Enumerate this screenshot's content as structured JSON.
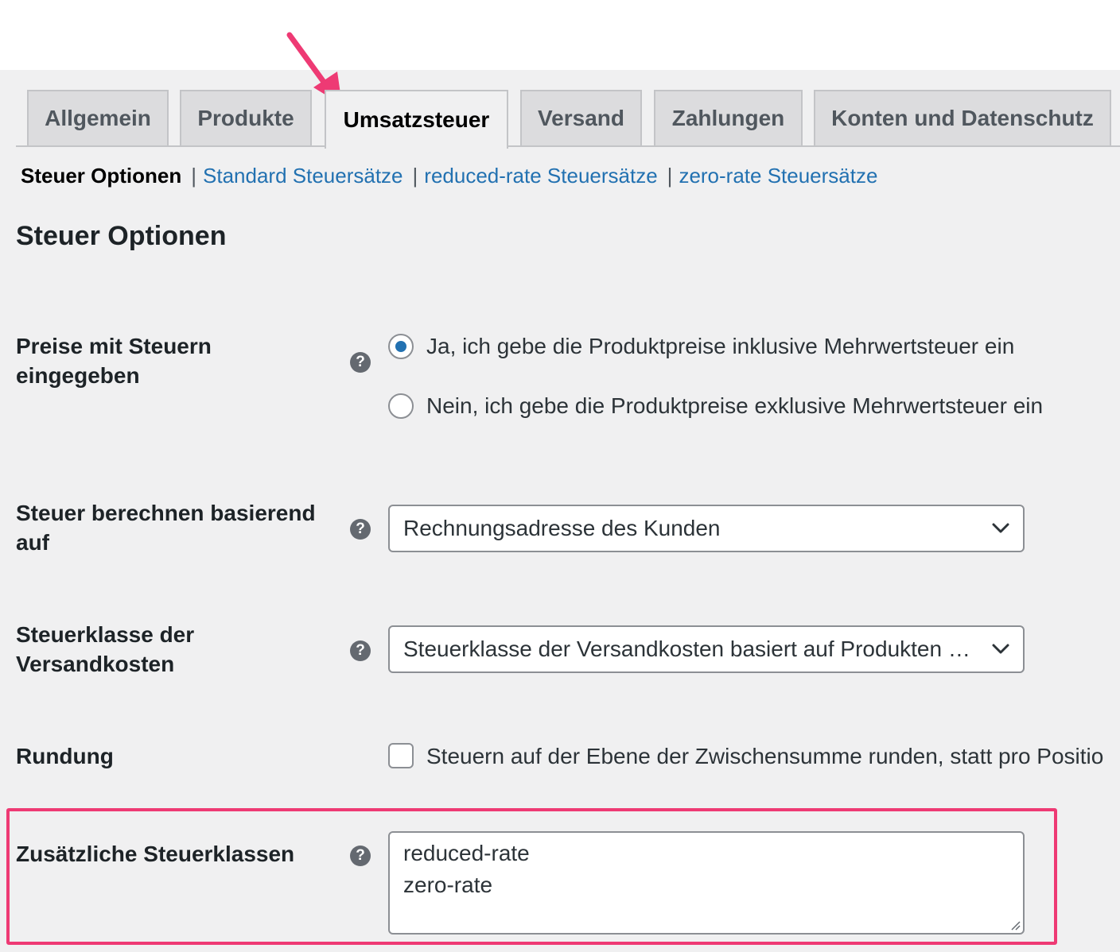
{
  "tabs": [
    {
      "label": "Allgemein"
    },
    {
      "label": "Produkte"
    },
    {
      "label": "Umsatzsteuer",
      "active": true
    },
    {
      "label": "Versand"
    },
    {
      "label": "Zahlungen"
    },
    {
      "label": "Konten und Datenschutz"
    }
  ],
  "subnav": {
    "current": "Steuer Optionen",
    "separator": "|",
    "links": [
      "Standard Steuersätze",
      "reduced-rate Steuersätze",
      "zero-rate Steuersätze"
    ]
  },
  "section_title": "Steuer Optionen",
  "fields": {
    "prices_incl_tax": {
      "label": "Preise mit Steuern eingegeben",
      "options": [
        {
          "label": "Ja, ich gebe die Produktpreise inklusive Mehrwertsteuer ein",
          "checked": true
        },
        {
          "label": "Nein, ich gebe die Produktpreise exklusive Mehrwertsteuer ein",
          "checked": false
        }
      ]
    },
    "tax_based_on": {
      "label": "Steuer berechnen basierend auf",
      "value": "Rechnungsadresse des Kunden"
    },
    "shipping_tax_class": {
      "label": "Steuerklasse der Versandkosten",
      "value": "Steuerklasse der Versandkosten basiert auf Produkten …"
    },
    "rounding": {
      "label": "Rundung",
      "checkbox_label": "Steuern auf der Ebene der Zwischensumme runden, statt pro Positio",
      "checked": false
    },
    "additional_tax_classes": {
      "label": "Zusätzliche Steuerklassen",
      "lines": [
        "reduced-rate",
        "zero-rate"
      ]
    }
  },
  "help_glyph": "?",
  "colors": {
    "annotation": "#ee3a74",
    "link": "#2271b1",
    "radio_checked": "#2271b1",
    "background": "#f0f0f1"
  },
  "icons": [
    "help-icon",
    "chevron-down-icon",
    "annotation-arrow-icon",
    "resize-grip-icon"
  ]
}
